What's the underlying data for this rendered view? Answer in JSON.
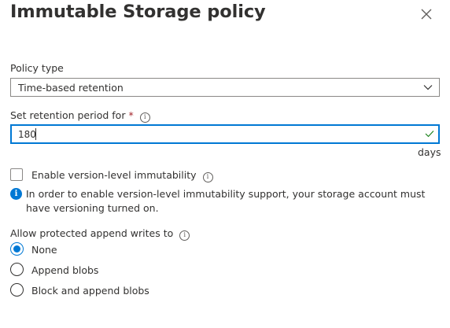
{
  "panel": {
    "title": "Immutable Storage policy",
    "close_icon": "close-icon"
  },
  "policy_type": {
    "label": "Policy type",
    "selected": "Time-based retention",
    "icon": "chevron-down-icon"
  },
  "retention": {
    "label": "Set retention period for",
    "required_marker": "*",
    "value": "180",
    "unit": "days",
    "valid_icon": "checkmark-icon",
    "info_icon": "info-icon"
  },
  "version_immutability": {
    "label": "Enable version-level immutability",
    "checked": false,
    "info_icon": "info-icon",
    "notice": "In order to enable version-level immutability support, your storage account must have versioning turned on.",
    "notice_icon": "info-filled-icon"
  },
  "append_writes": {
    "label": "Allow protected append writes to",
    "info_icon": "info-icon",
    "options": [
      {
        "label": "None",
        "selected": true
      },
      {
        "label": "Append blobs",
        "selected": false
      },
      {
        "label": "Block and append blobs",
        "selected": false
      }
    ]
  },
  "colors": {
    "accent": "#0078d4",
    "text": "#323130",
    "border": "#8a8886",
    "required": "#a4262c"
  }
}
